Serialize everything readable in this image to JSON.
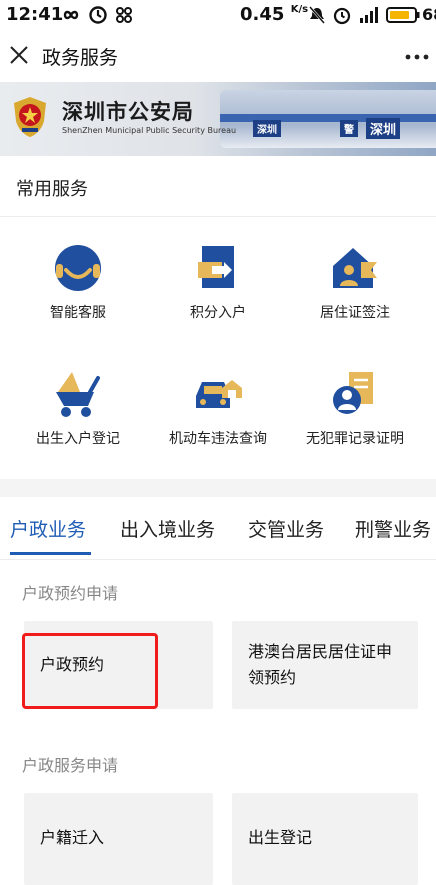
{
  "status_bar": {
    "time": "12:41",
    "speed_value": "0.45",
    "speed_unit": "K/s",
    "battery_text": "68"
  },
  "nav": {
    "title": "政务服务",
    "close_icon": "close-icon",
    "more_icon": "more-icon"
  },
  "banner": {
    "title": "深圳市公安局",
    "subtitle": "ShenZhen Municipal Public Security Bureau",
    "sign_1": "深圳",
    "sign_2": "警",
    "sign_3": "深圳",
    "colors": {
      "accent": "#1d3f86"
    }
  },
  "common_services": {
    "title": "常用服务",
    "items": [
      {
        "label": "智能客服",
        "icon": "customer-service-icon"
      },
      {
        "label": "积分入户",
        "icon": "points-settle-icon"
      },
      {
        "label": "居住证签注",
        "icon": "residence-permit-icon"
      },
      {
        "label": "出生入户登记",
        "icon": "birth-registration-icon"
      },
      {
        "label": "机动车违法查询",
        "icon": "vehicle-violation-icon"
      },
      {
        "label": "无犯罪记录证明",
        "icon": "no-criminal-record-icon"
      }
    ]
  },
  "tabs": [
    {
      "label": "户政业务",
      "active": true
    },
    {
      "label": "出入境业务",
      "active": false
    },
    {
      "label": "交管业务",
      "active": false
    },
    {
      "label": "刑警业务",
      "active": false
    }
  ],
  "groups": [
    {
      "title": "户政预约申请",
      "cards": [
        {
          "label": "户政预约"
        },
        {
          "label_line1": "港澳台居民居住证申",
          "label_line2": "领预约"
        }
      ]
    },
    {
      "title": "户政服务申请",
      "cards": [
        {
          "label": "户籍迁入"
        },
        {
          "label": "出生登记"
        }
      ]
    }
  ],
  "colors": {
    "active_tab": "#1f5db5",
    "highlight": "#f01b1b",
    "icon_blue": "#1f4f9e",
    "icon_gold": "#e7b85a"
  }
}
